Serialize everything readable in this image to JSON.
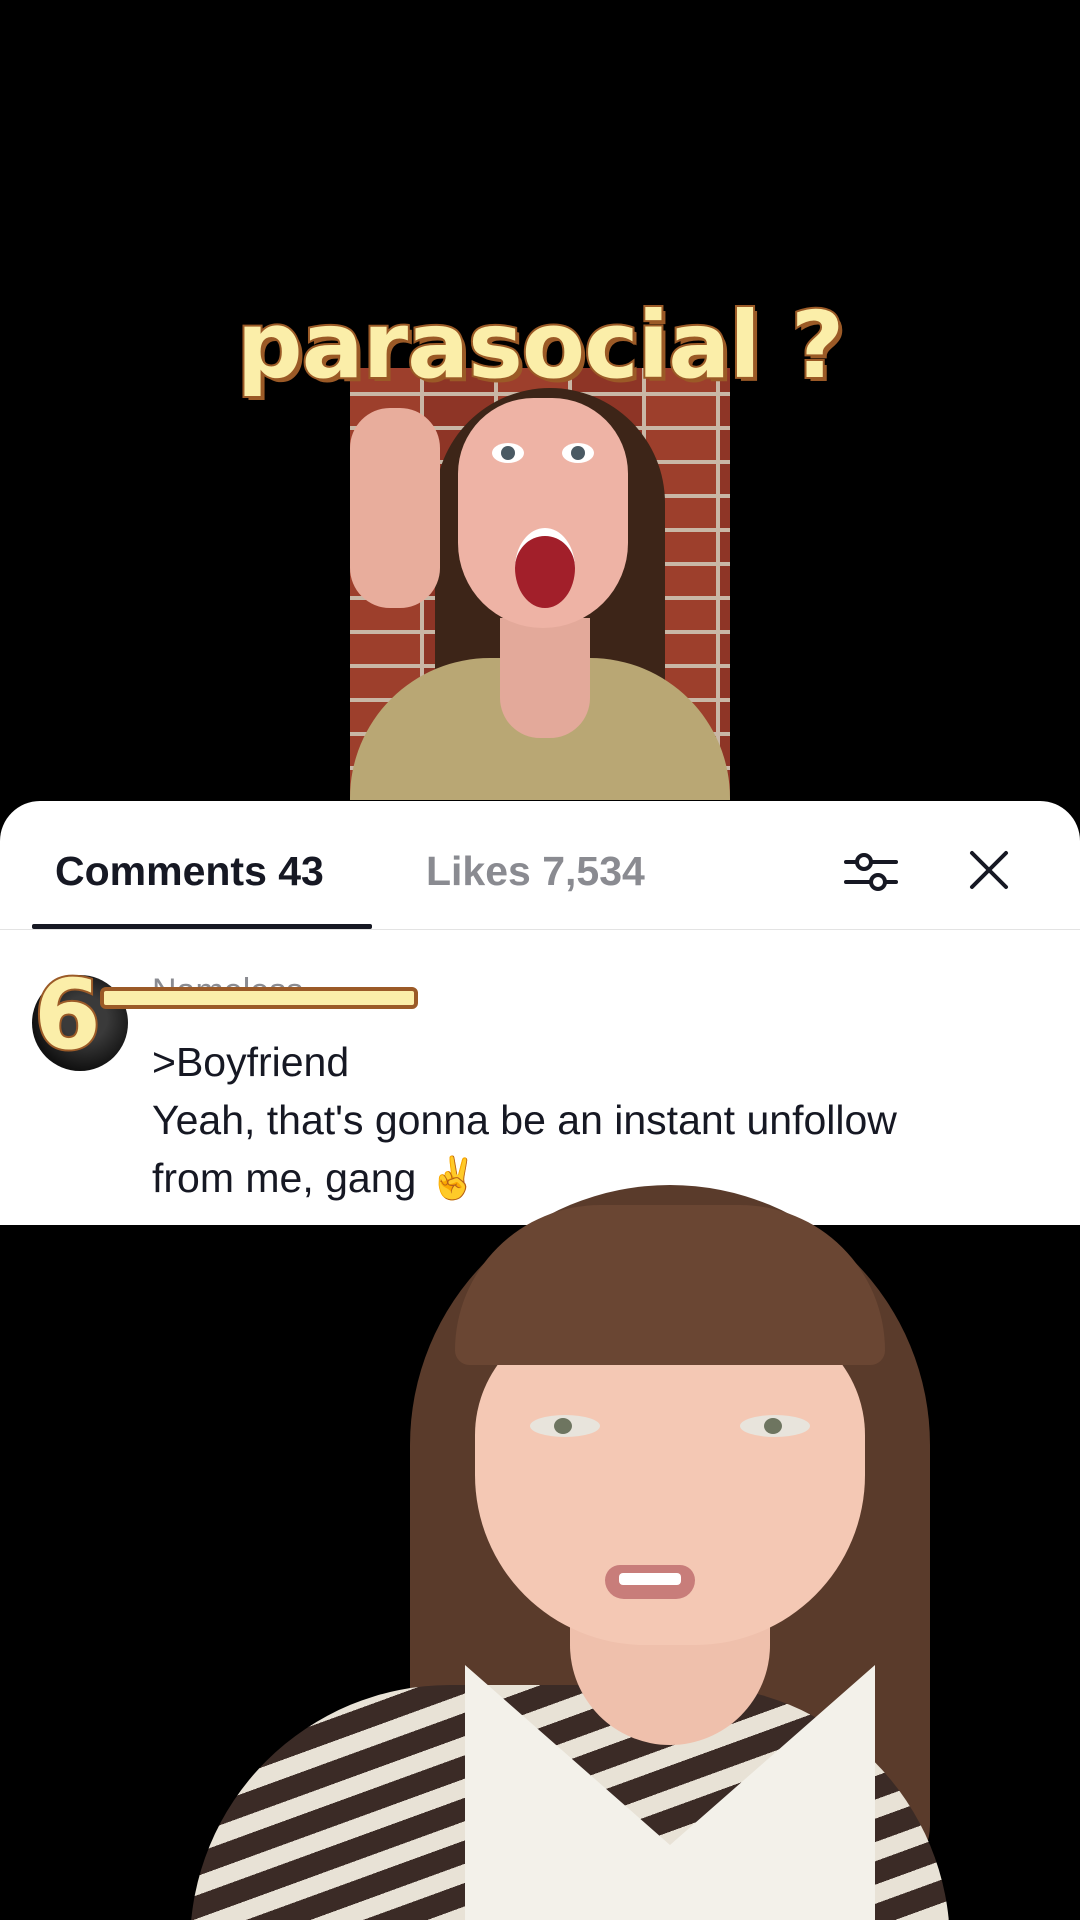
{
  "overlay": {
    "caption": "parasocial ?",
    "rank_number": "6"
  },
  "panel": {
    "tabs": [
      {
        "label": "Comments 43",
        "active": true
      },
      {
        "label": "Likes 7,534",
        "active": false
      }
    ],
    "filter_icon": "sliders-icon",
    "close_icon": "close-icon"
  },
  "comment": {
    "username": "Nameless",
    "lines": [
      ">Boyfriend",
      "Yeah, that's gonna be an instant unfollow",
      "from me, gang ✌️"
    ]
  },
  "colors": {
    "caption_fill": "#fbeea9",
    "caption_stroke": "#9b5a27",
    "text_primary": "#161823",
    "text_secondary": "#8a8b91"
  }
}
